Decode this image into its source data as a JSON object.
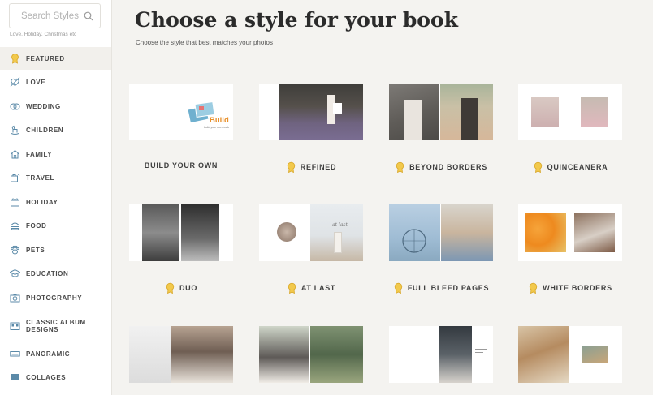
{
  "sidebar": {
    "search_placeholder": "Search Styles",
    "search_hint": "Love, Holiday, Christmas etc",
    "categories": [
      {
        "label": "FEATURED",
        "icon": "award-icon"
      },
      {
        "label": "LOVE",
        "icon": "heart-arrow-icon"
      },
      {
        "label": "WEDDING",
        "icon": "rings-icon"
      },
      {
        "label": "CHILDREN",
        "icon": "rocking-horse-icon"
      },
      {
        "label": "FAMILY",
        "icon": "house-icon"
      },
      {
        "label": "TRAVEL",
        "icon": "suitcase-icon"
      },
      {
        "label": "HOLIDAY",
        "icon": "gift-icon"
      },
      {
        "label": "FOOD",
        "icon": "burger-icon"
      },
      {
        "label": "PETS",
        "icon": "paw-icon"
      },
      {
        "label": "EDUCATION",
        "icon": "graduation-cap-icon"
      },
      {
        "label": "PHOTOGRAPHY",
        "icon": "camera-icon"
      },
      {
        "label": "CLASSIC ALBUM\nDESIGNS",
        "icon": "album-icon"
      },
      {
        "label": "PANORAMIC",
        "icon": "panorama-icon"
      },
      {
        "label": "COLLAGES",
        "icon": "collage-icon"
      }
    ],
    "active_index": 0
  },
  "main": {
    "title": "Choose a style for your book",
    "subtitle": "Choose the style that best matches your photos",
    "styles": [
      {
        "label": "BUILD YOUR OWN",
        "badge": false,
        "thumb_text": "Build",
        "thumb_subtext": "build your own book"
      },
      {
        "label": "REFINED",
        "badge": true
      },
      {
        "label": "BEYOND BORDERS",
        "badge": true
      },
      {
        "label": "QUINCEANERA",
        "badge": true
      },
      {
        "label": "DUO",
        "badge": true
      },
      {
        "label": "AT LAST",
        "badge": true,
        "thumb_text": "at last"
      },
      {
        "label": "FULL BLEED PAGES",
        "badge": true
      },
      {
        "label": "WHITE BORDERS",
        "badge": true
      },
      {
        "label": "",
        "badge": false
      },
      {
        "label": "",
        "badge": false
      },
      {
        "label": "",
        "badge": false
      },
      {
        "label": "",
        "badge": false
      }
    ]
  },
  "colors": {
    "background": "#f4f3f0",
    "badge_gold": "#f2c94c",
    "build_orange": "#e8902b",
    "sidebar_active": "#f2f0ec"
  }
}
